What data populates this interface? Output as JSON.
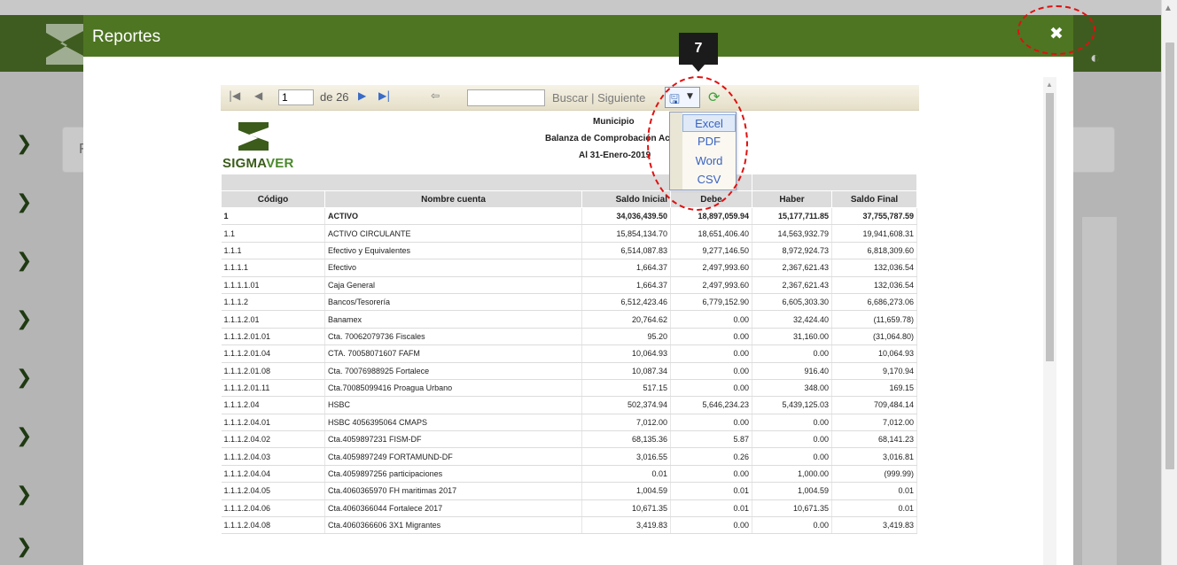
{
  "modal": {
    "title": "Reportes"
  },
  "annotation": {
    "step": "7"
  },
  "toolbar": {
    "page_value": "1",
    "page_of": "de 26",
    "find_label": "Buscar",
    "separator": "|",
    "next_label": "Siguiente"
  },
  "export_menu": {
    "items": [
      {
        "label": "Excel"
      },
      {
        "label": "PDF"
      },
      {
        "label": "Word"
      },
      {
        "label": "CSV"
      }
    ]
  },
  "report": {
    "logo_text": "SIGMA",
    "logo_text_2": "VER",
    "header_line1": "Municipio",
    "header_line2": "Balanza de Comprobación Acum",
    "header_line3": "Al 31-Enero-2019",
    "group_header": "vimientos",
    "columns": [
      "Código",
      "Nombre cuenta",
      "Saldo Inicial",
      "Debe",
      "Haber",
      "Saldo Final"
    ],
    "rows": [
      [
        "1",
        "ACTIVO",
        "34,036,439.50",
        "18,897,059.94",
        "15,177,711.85",
        "37,755,787.59"
      ],
      [
        "1.1",
        "ACTIVO CIRCULANTE",
        "15,854,134.70",
        "18,651,406.40",
        "14,563,932.79",
        "19,941,608.31"
      ],
      [
        "1.1.1",
        "Efectivo y Equivalentes",
        "6,514,087.83",
        "9,277,146.50",
        "8,972,924.73",
        "6,818,309.60"
      ],
      [
        "1.1.1.1",
        "Efectivo",
        "1,664.37",
        "2,497,993.60",
        "2,367,621.43",
        "132,036.54"
      ],
      [
        "1.1.1.1.01",
        "Caja General",
        "1,664.37",
        "2,497,993.60",
        "2,367,621.43",
        "132,036.54"
      ],
      [
        "1.1.1.2",
        "Bancos/Tesorería",
        "6,512,423.46",
        "6,779,152.90",
        "6,605,303.30",
        "6,686,273.06"
      ],
      [
        "1.1.1.2.01",
        "Banamex",
        "20,764.62",
        "0.00",
        "32,424.40",
        "(11,659.78)"
      ],
      [
        "1.1.1.2.01.01",
        "Cta. 70062079736 Fiscales",
        "95.20",
        "0.00",
        "31,160.00",
        "(31,064.80)"
      ],
      [
        "1.1.1.2.01.04",
        "CTA. 70058071607 FAFM",
        "10,064.93",
        "0.00",
        "0.00",
        "10,064.93"
      ],
      [
        "1.1.1.2.01.08",
        "Cta. 70076988925 Fortalece",
        "10,087.34",
        "0.00",
        "916.40",
        "9,170.94"
      ],
      [
        "1.1.1.2.01.11",
        "Cta.70085099416 Proagua Urbano",
        "517.15",
        "0.00",
        "348.00",
        "169.15"
      ],
      [
        "1.1.1.2.04",
        "HSBC",
        "502,374.94",
        "5,646,234.23",
        "5,439,125.03",
        "709,484.14"
      ],
      [
        "1.1.1.2.04.01",
        "HSBC 4056395064 CMAPS",
        "7,012.00",
        "0.00",
        "0.00",
        "7,012.00"
      ],
      [
        "1.1.1.2.04.02",
        "Cta.4059897231 FISM-DF",
        "68,135.36",
        "5.87",
        "0.00",
        "68,141.23"
      ],
      [
        "1.1.1.2.04.03",
        "Cta.4059897249 FORTAMUND-DF",
        "3,016.55",
        "0.26",
        "0.00",
        "3,016.81"
      ],
      [
        "1.1.1.2.04.04",
        "Cta.4059897256 participaciones",
        "0.01",
        "0.00",
        "1,000.00",
        "(999.99)"
      ],
      [
        "1.1.1.2.04.05",
        "Cta.4060365970 FH maritimas 2017",
        "1,004.59",
        "0.01",
        "1,004.59",
        "0.01"
      ],
      [
        "1.1.1.2.04.06",
        "Cta.4060366044 Fortalece 2017",
        "10,671.35",
        "0.01",
        "10,671.35",
        "0.01"
      ],
      [
        "1.1.1.2.04.08",
        "Cta.4060366606 3X1 Migrantes",
        "3,419.83",
        "0.00",
        "0.00",
        "3,419.83"
      ]
    ]
  }
}
